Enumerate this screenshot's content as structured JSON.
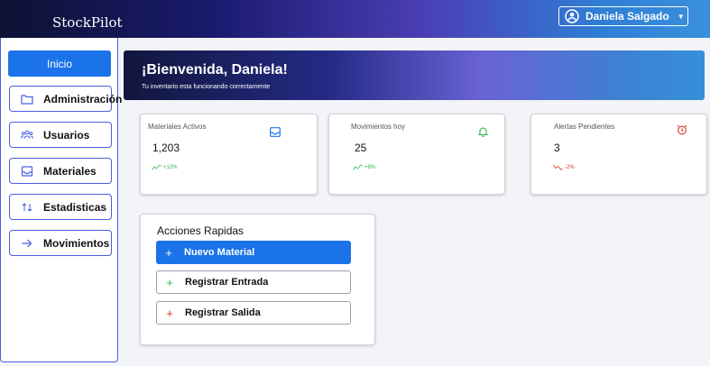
{
  "app": {
    "brand": "StockPilot"
  },
  "user": {
    "name": "Daniela Salgado"
  },
  "sidebar": {
    "items": [
      {
        "label": "Inicio",
        "icon": "home",
        "active": true
      },
      {
        "label": "Administración",
        "icon": "folder-icon"
      },
      {
        "label": "Usuarios",
        "icon": "users-icon"
      },
      {
        "label": "Materiales",
        "icon": "inbox-icon"
      },
      {
        "label": "Estadisticas",
        "icon": "sort-arrows-icon"
      },
      {
        "label": "Movimientos",
        "icon": "arrow-right-icon"
      }
    ]
  },
  "banner": {
    "title": "¡Bienvenida, Daniela!",
    "subtitle": "Tu inventario esta funcionando correctamente"
  },
  "cards": [
    {
      "title": "Materiales Activos",
      "value": "1,203",
      "trend": "+12%",
      "trend_color": "#2ab34a",
      "icon": "inbox-icon",
      "icon_color": "#1a73e8"
    },
    {
      "title": "Movimientos hoy",
      "value": "25",
      "trend": "+8%",
      "trend_color": "#2ab34a",
      "icon": "bell-icon",
      "icon_color": "#2ab34a"
    },
    {
      "title": "Alertas Pendientes",
      "value": "3",
      "trend": "-2%",
      "trend_color": "#d93025",
      "icon": "alarm-clock-icon",
      "icon_color": "#d93025"
    }
  ],
  "actions": {
    "title": "Acciones Rapidas",
    "buttons": [
      {
        "label": "Nuevo Material",
        "plus_color": "#ffffff"
      },
      {
        "label": "Registrar Entrada",
        "plus_color": "#2ab34a"
      },
      {
        "label": "Registrar Salida",
        "plus_color": "#d93025"
      }
    ]
  }
}
